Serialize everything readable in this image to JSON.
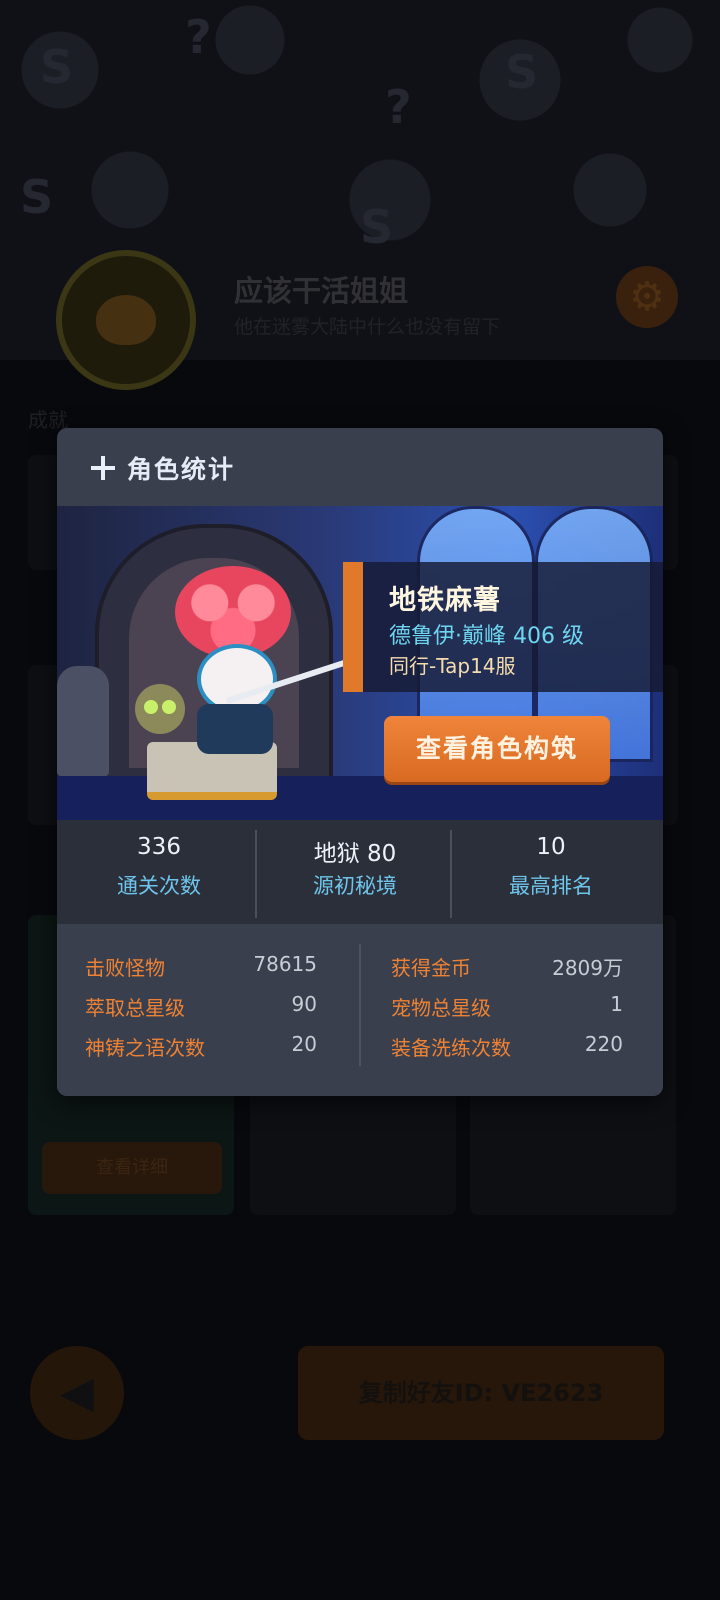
{
  "profile": {
    "name": "应该干活姐姐",
    "motto": "他在迷雾大陆中什么也没有留下",
    "section_label": "成就",
    "detail_button": "查看详细",
    "copy_friend_button": "复制好友ID: VE2623"
  },
  "modal": {
    "title": "角色统计",
    "character": {
      "name": "地铁麻薯",
      "class_line": "德鲁伊·巅峰 406 级",
      "server_line": "同行-Tap14服"
    },
    "build_button": "查看角色构筑",
    "top_stats": [
      {
        "value": "336",
        "label": "通关次数"
      },
      {
        "value": "地狱 80",
        "label": "源初秘境"
      },
      {
        "value": "10",
        "label": "最高排名"
      }
    ],
    "detail_stats_left": [
      {
        "label": "击败怪物",
        "value": "78615"
      },
      {
        "label": "萃取总星级",
        "value": "90"
      },
      {
        "label": "神铸之语次数",
        "value": "20"
      }
    ],
    "detail_stats_right": [
      {
        "label": "获得金币",
        "value": "2809万"
      },
      {
        "label": "宠物总星级",
        "value": "1"
      },
      {
        "label": "装备洗练次数",
        "value": "220"
      }
    ]
  },
  "colors": {
    "accent_orange": "#e0792a",
    "label_blue": "#6ec4ea",
    "stat_label_orange": "#ee8234",
    "modal_bg": "#3a3f4d"
  }
}
